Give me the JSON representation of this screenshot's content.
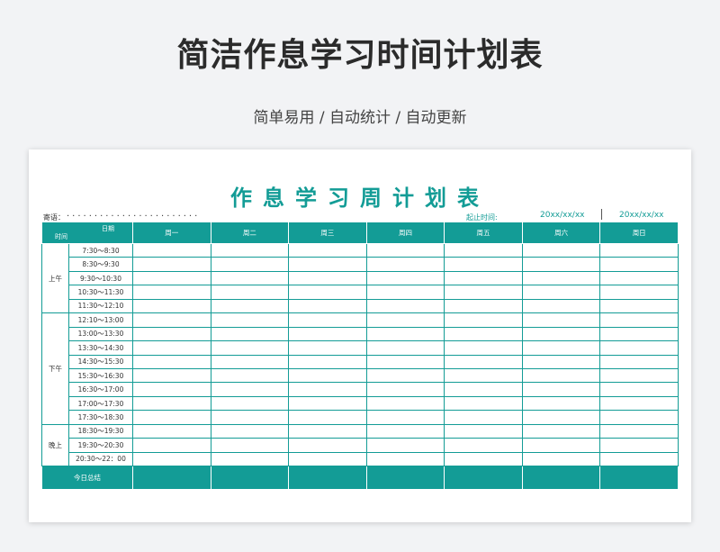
{
  "page": {
    "title": "简洁作息学习时间计划表",
    "subtitle": "简单易用 / 自动统计 / 自动更新"
  },
  "sheet": {
    "title": "作息学习周计划表",
    "motto_label": "寄语：",
    "motto_dots": "........................",
    "date_label": "起止时间:",
    "date_start": "20xx/xx/xx",
    "date_end": "20xx/xx/xx",
    "corner_date": "日期",
    "corner_time": "时间",
    "days": [
      "周一",
      "周二",
      "周三",
      "周四",
      "周五",
      "周六",
      "周日"
    ],
    "periods": [
      {
        "label": "上午",
        "slots": [
          "7:30～8:30",
          "8:30～9:30",
          "9:30～10:30",
          "10:30～11:30",
          "11:30～12:10"
        ]
      },
      {
        "label": "下午",
        "slots": [
          "12:10～13:00",
          "13:00～13:30",
          "13:30～14:30",
          "14:30～15:30",
          "15:30～16:30",
          "16:30～17:00",
          "17:00～17:30",
          "17:30～18:30"
        ]
      },
      {
        "label": "晚上",
        "slots": [
          "18:30～19:30",
          "19:30～20:30",
          "20:30～22：00"
        ]
      }
    ],
    "summary_label": "今日总结",
    "accent_color": "#139c96"
  }
}
